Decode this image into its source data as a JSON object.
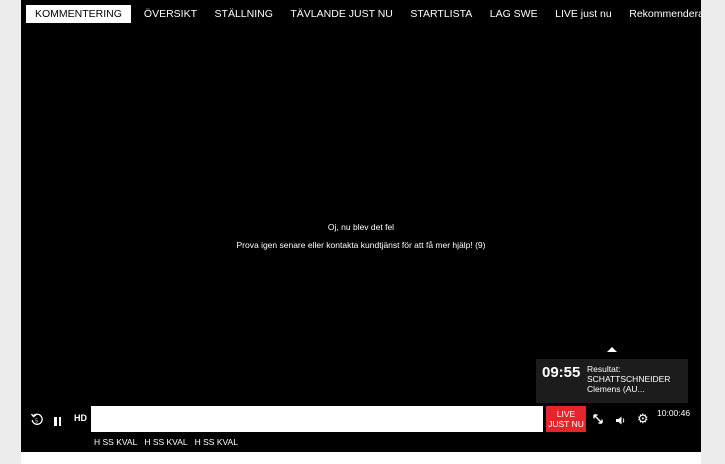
{
  "tabs": [
    {
      "label": "KOMMENTERING",
      "active": true
    },
    {
      "label": "ÖVERSIKT"
    },
    {
      "label": "STÄLLNING"
    },
    {
      "label": "TÄVLANDE JUST NU"
    },
    {
      "label": "STARTLISTA"
    },
    {
      "label": "LAG SWE"
    },
    {
      "label": "LIVE just nu"
    },
    {
      "label": "Rekommenderat"
    }
  ],
  "player": {
    "error_title": "Oj, nu blev det fel",
    "error_message": "Prova igen senare eller kontakta kundtjänst för att få mer hjälp! (9)",
    "result_card": {
      "time": "09:55",
      "label": "Resultat:",
      "name_line1": "SCHATTSCHNEIDER",
      "name_line2": "Clemens (AU..."
    },
    "controls": {
      "hd_label": "HD",
      "live_label_line1": "LIVE",
      "live_label_line2": "JUST NU",
      "clock": "10:00:46"
    },
    "markers": [
      "H SS KVAL",
      "H SS KVAL",
      "H SS KVAL"
    ]
  },
  "colors": {
    "player_bg": "#000000",
    "live_red": "#e4252b",
    "page_bg": "#ececec"
  },
  "icons": {
    "replay": "replay-icon",
    "pause": "pause-icon",
    "expand": "expand-icon",
    "volume": "volume-icon",
    "settings": "gear-icon",
    "caret": "caret-up-icon"
  }
}
